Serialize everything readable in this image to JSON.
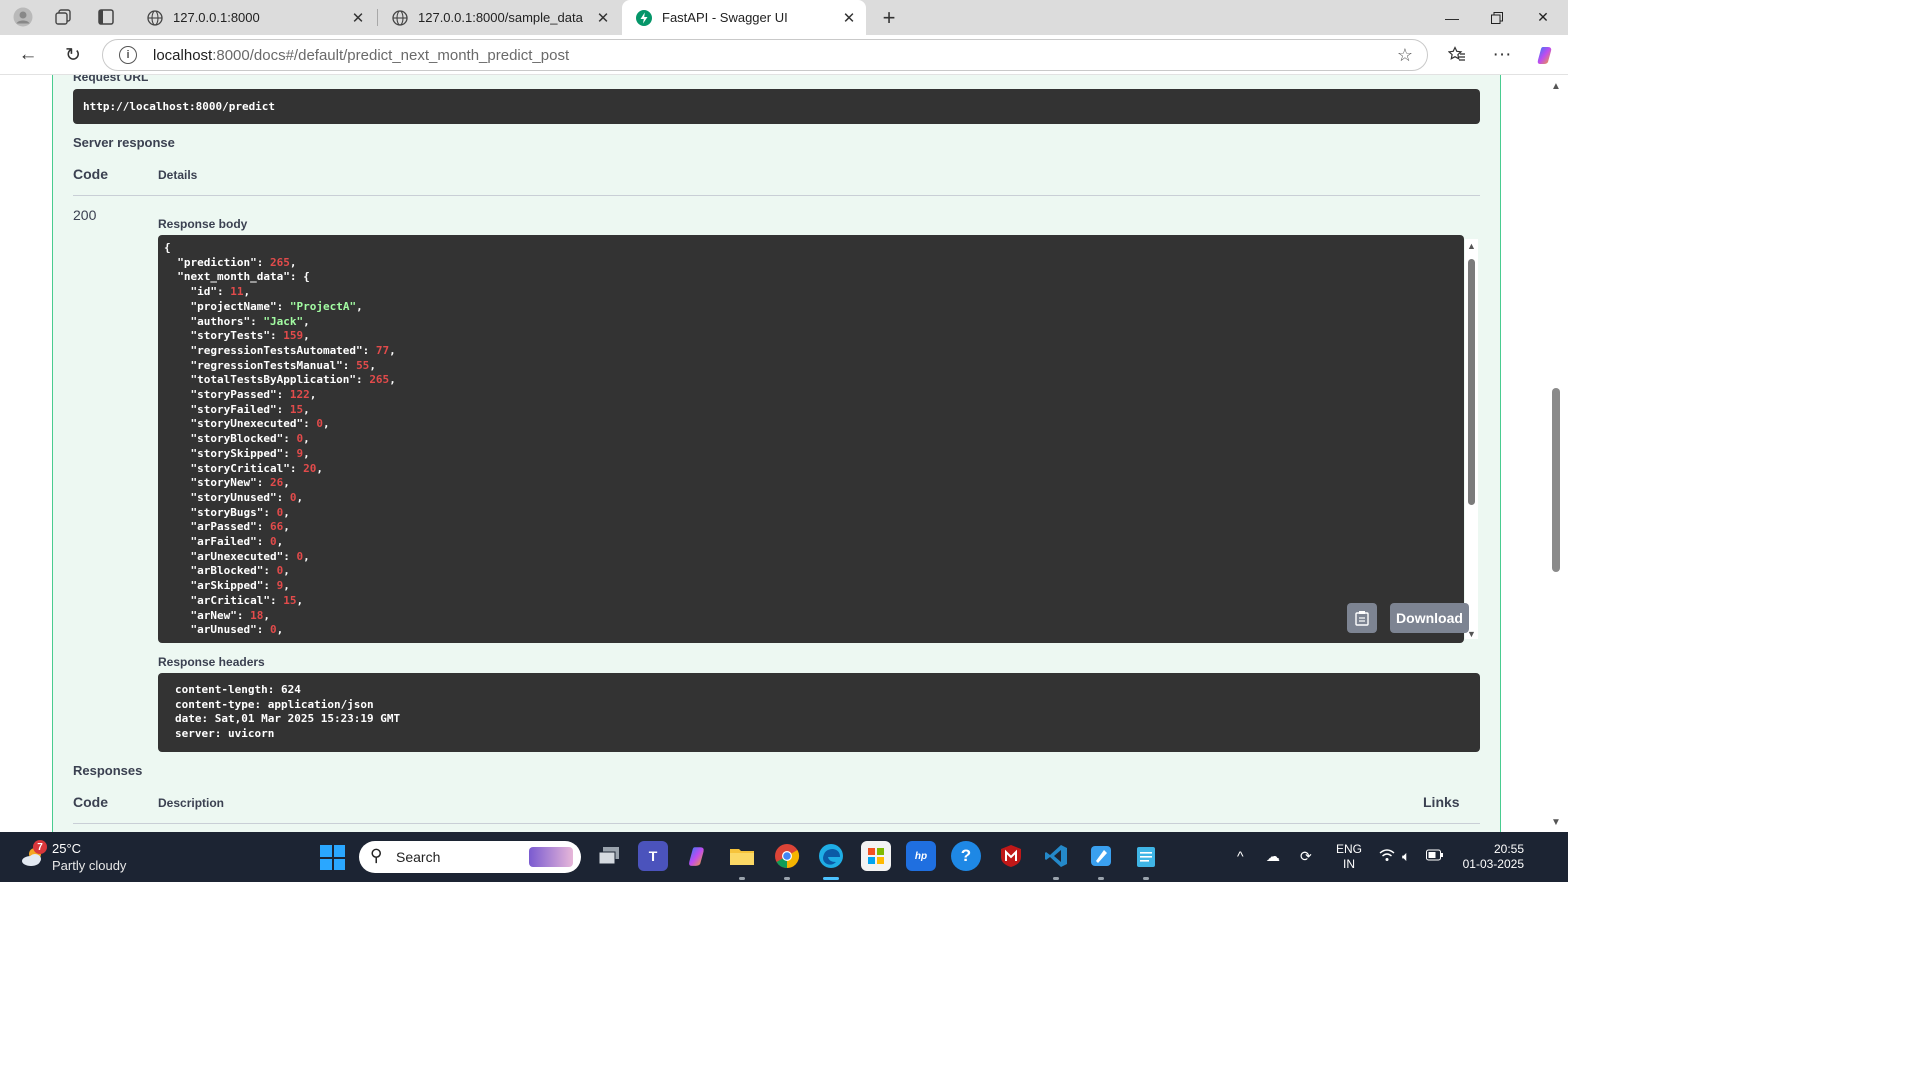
{
  "browser": {
    "tabs": [
      {
        "title": "127.0.0.1:8000",
        "active": false
      },
      {
        "title": "127.0.0.1:8000/sample_data",
        "active": false
      },
      {
        "title": "FastAPI - Swagger UI",
        "active": true
      }
    ],
    "address": {
      "host": "localhost",
      "rest": ":8000/docs#/default/predict_next_month_predict_post"
    }
  },
  "swagger": {
    "request_url_label": "Request URL",
    "request_url": "http://localhost:8000/predict",
    "server_response_label": "Server response",
    "code_header": "Code",
    "details_header": "Details",
    "status_code": "200",
    "response_body_label": "Response body",
    "response_body_lines": [
      [
        [
          "p",
          "{"
        ]
      ],
      [
        [
          "p",
          "  \"prediction\": "
        ],
        [
          "n",
          "265"
        ],
        [
          "p",
          ","
        ]
      ],
      [
        [
          "p",
          "  \"next_month_data\": {"
        ]
      ],
      [
        [
          "p",
          "    \"id\": "
        ],
        [
          "n",
          "11"
        ],
        [
          "p",
          ","
        ]
      ],
      [
        [
          "p",
          "    \"projectName\": "
        ],
        [
          "s",
          "\"ProjectA\""
        ],
        [
          "p",
          ","
        ]
      ],
      [
        [
          "p",
          "    \"authors\": "
        ],
        [
          "s",
          "\"Jack\""
        ],
        [
          "p",
          ","
        ]
      ],
      [
        [
          "p",
          "    \"storyTests\": "
        ],
        [
          "n",
          "159"
        ],
        [
          "p",
          ","
        ]
      ],
      [
        [
          "p",
          "    \"regressionTestsAutomated\": "
        ],
        [
          "n",
          "77"
        ],
        [
          "p",
          ","
        ]
      ],
      [
        [
          "p",
          "    \"regressionTestsManual\": "
        ],
        [
          "n",
          "55"
        ],
        [
          "p",
          ","
        ]
      ],
      [
        [
          "p",
          "    \"totalTestsByApplication\": "
        ],
        [
          "n",
          "265"
        ],
        [
          "p",
          ","
        ]
      ],
      [
        [
          "p",
          "    \"storyPassed\": "
        ],
        [
          "n",
          "122"
        ],
        [
          "p",
          ","
        ]
      ],
      [
        [
          "p",
          "    \"storyFailed\": "
        ],
        [
          "n",
          "15"
        ],
        [
          "p",
          ","
        ]
      ],
      [
        [
          "p",
          "    \"storyUnexecuted\": "
        ],
        [
          "n",
          "0"
        ],
        [
          "p",
          ","
        ]
      ],
      [
        [
          "p",
          "    \"storyBlocked\": "
        ],
        [
          "n",
          "0"
        ],
        [
          "p",
          ","
        ]
      ],
      [
        [
          "p",
          "    \"storySkipped\": "
        ],
        [
          "n",
          "9"
        ],
        [
          "p",
          ","
        ]
      ],
      [
        [
          "p",
          "    \"storyCritical\": "
        ],
        [
          "n",
          "20"
        ],
        [
          "p",
          ","
        ]
      ],
      [
        [
          "p",
          "    \"storyNew\": "
        ],
        [
          "n",
          "26"
        ],
        [
          "p",
          ","
        ]
      ],
      [
        [
          "p",
          "    \"storyUnused\": "
        ],
        [
          "n",
          "0"
        ],
        [
          "p",
          ","
        ]
      ],
      [
        [
          "p",
          "    \"storyBugs\": "
        ],
        [
          "n",
          "0"
        ],
        [
          "p",
          ","
        ]
      ],
      [
        [
          "p",
          "    \"arPassed\": "
        ],
        [
          "n",
          "66"
        ],
        [
          "p",
          ","
        ]
      ],
      [
        [
          "p",
          "    \"arFailed\": "
        ],
        [
          "n",
          "0"
        ],
        [
          "p",
          ","
        ]
      ],
      [
        [
          "p",
          "    \"arUnexecuted\": "
        ],
        [
          "n",
          "0"
        ],
        [
          "p",
          ","
        ]
      ],
      [
        [
          "p",
          "    \"arBlocked\": "
        ],
        [
          "n",
          "0"
        ],
        [
          "p",
          ","
        ]
      ],
      [
        [
          "p",
          "    \"arSkipped\": "
        ],
        [
          "n",
          "9"
        ],
        [
          "p",
          ","
        ]
      ],
      [
        [
          "p",
          "    \"arCritical\": "
        ],
        [
          "n",
          "15"
        ],
        [
          "p",
          ","
        ]
      ],
      [
        [
          "p",
          "    \"arNew\": "
        ],
        [
          "n",
          "18"
        ],
        [
          "p",
          ","
        ]
      ],
      [
        [
          "p",
          "    \"arUnused\": "
        ],
        [
          "n",
          "0"
        ],
        [
          "p",
          ","
        ]
      ]
    ],
    "download_label": "Download",
    "response_headers_label": "Response headers",
    "response_headers": "content-length: 624\ncontent-type: application/json\ndate: Sat,01 Mar 2025 15:23:19 GMT\nserver: uvicorn",
    "responses_label": "Responses",
    "responses_code_header": "Code",
    "description_header": "Description",
    "links_header": "Links"
  },
  "taskbar": {
    "weather_badge": "7",
    "temperature": "25°C",
    "condition": "Partly cloudy",
    "search_placeholder": "Search",
    "lang_1": "ENG",
    "lang_2": "IN",
    "time": "20:55",
    "date": "01-03-2025"
  }
}
